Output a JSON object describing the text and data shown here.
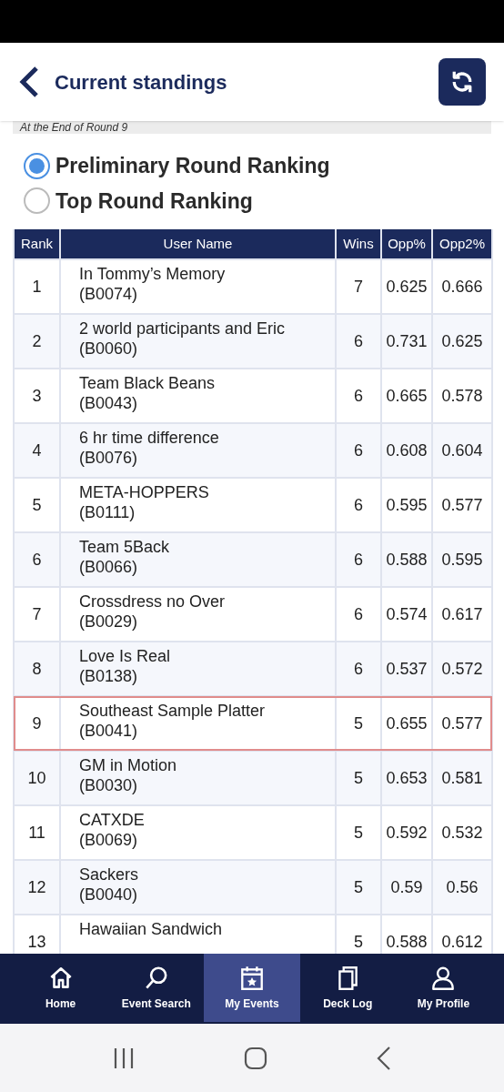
{
  "header": {
    "title": "Current standings"
  },
  "round_caption": "At the End of Round 9",
  "ranking_options": [
    {
      "label": "Preliminary Round Ranking",
      "selected": true
    },
    {
      "label": "Top Round Ranking",
      "selected": false
    }
  ],
  "table": {
    "columns": [
      "Rank",
      "User Name",
      "Wins",
      "Opp%",
      "Opp2%"
    ],
    "rows": [
      {
        "rank": "1",
        "name": "In Tommy’s Memory",
        "code": "(B0074)",
        "wins": "7",
        "opp": "0.625",
        "opp2": "0.666",
        "highlighted": false
      },
      {
        "rank": "2",
        "name": "2 world participants and Eric",
        "code": "(B0060)",
        "wins": "6",
        "opp": "0.731",
        "opp2": "0.625",
        "highlighted": false
      },
      {
        "rank": "3",
        "name": "Team Black Beans",
        "code": "(B0043)",
        "wins": "6",
        "opp": "0.665",
        "opp2": "0.578",
        "highlighted": false
      },
      {
        "rank": "4",
        "name": "6 hr time difference",
        "code": "(B0076)",
        "wins": "6",
        "opp": "0.608",
        "opp2": "0.604",
        "highlighted": false
      },
      {
        "rank": "5",
        "name": "META-HOPPERS",
        "code": "(B0111)",
        "wins": "6",
        "opp": "0.595",
        "opp2": "0.577",
        "highlighted": false
      },
      {
        "rank": "6",
        "name": "Team 5Back",
        "code": "(B0066)",
        "wins": "6",
        "opp": "0.588",
        "opp2": "0.595",
        "highlighted": false
      },
      {
        "rank": "7",
        "name": "Crossdress no Over",
        "code": "(B0029)",
        "wins": "6",
        "opp": "0.574",
        "opp2": "0.617",
        "highlighted": false
      },
      {
        "rank": "8",
        "name": "Love Is Real",
        "code": "(B0138)",
        "wins": "6",
        "opp": "0.537",
        "opp2": "0.572",
        "highlighted": false
      },
      {
        "rank": "9",
        "name": "Southeast Sample Platter",
        "code": "(B0041)",
        "wins": "5",
        "opp": "0.655",
        "opp2": "0.577",
        "highlighted": true
      },
      {
        "rank": "10",
        "name": "GM in Motion",
        "code": "(B0030)",
        "wins": "5",
        "opp": "0.653",
        "opp2": "0.581",
        "highlighted": false
      },
      {
        "rank": "11",
        "name": "CATXDE",
        "code": "(B0069)",
        "wins": "5",
        "opp": "0.592",
        "opp2": "0.532",
        "highlighted": false
      },
      {
        "rank": "12",
        "name": "Sackers",
        "code": "(B0040)",
        "wins": "5",
        "opp": "0.59",
        "opp2": "0.56",
        "highlighted": false
      },
      {
        "rank": "13",
        "name": "Hawaiian Sandwich",
        "wins": "5",
        "opp": "0.588",
        "opp2": "0.612",
        "highlighted": false
      }
    ]
  },
  "bottom_nav": [
    {
      "kind": "home",
      "label": "Home",
      "selected": false
    },
    {
      "kind": "search",
      "label": "Event Search",
      "selected": false
    },
    {
      "kind": "calendar",
      "label": "My Events",
      "selected": true
    },
    {
      "kind": "cards",
      "label": "Deck Log",
      "selected": false
    },
    {
      "kind": "profile",
      "label": "My Profile",
      "selected": false
    }
  ]
}
